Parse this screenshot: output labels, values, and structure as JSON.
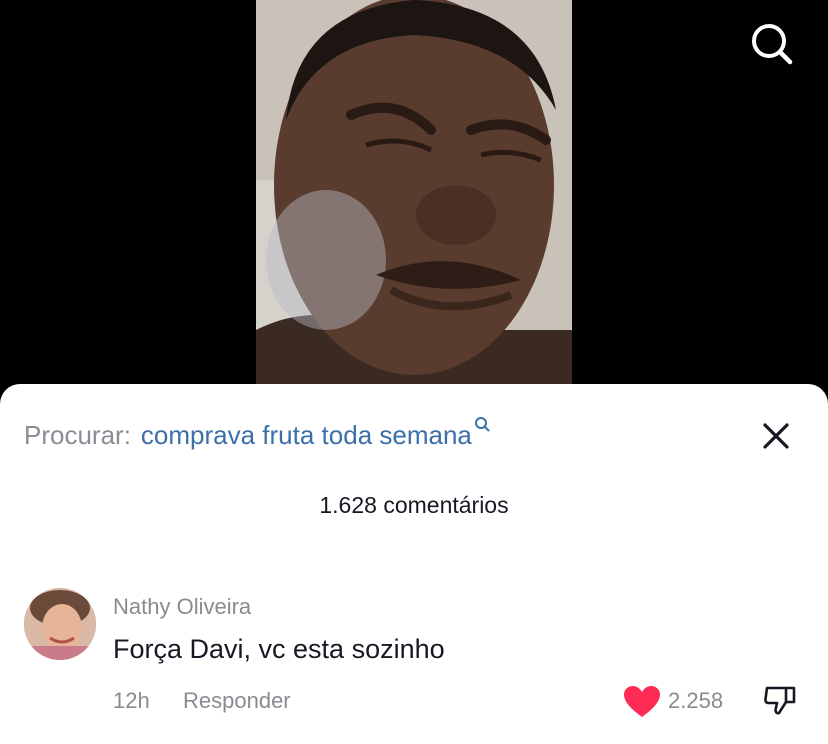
{
  "video": {
    "search_icon": "search-icon"
  },
  "search": {
    "label": "Procurar:",
    "term": "comprava fruta toda semana",
    "close_icon": "close-icon"
  },
  "comments": {
    "count_label": "1.628 comentários",
    "items": [
      {
        "username": "Nathy Oliveira",
        "text": "Força Davi, vc esta sozinho",
        "time": "12h",
        "reply_label": "Responder",
        "likes": "2.258",
        "liked": true
      }
    ]
  },
  "colors": {
    "like": "#fe2c55",
    "search_term": "#3b6fa8",
    "muted_text": "#8a8b91"
  }
}
